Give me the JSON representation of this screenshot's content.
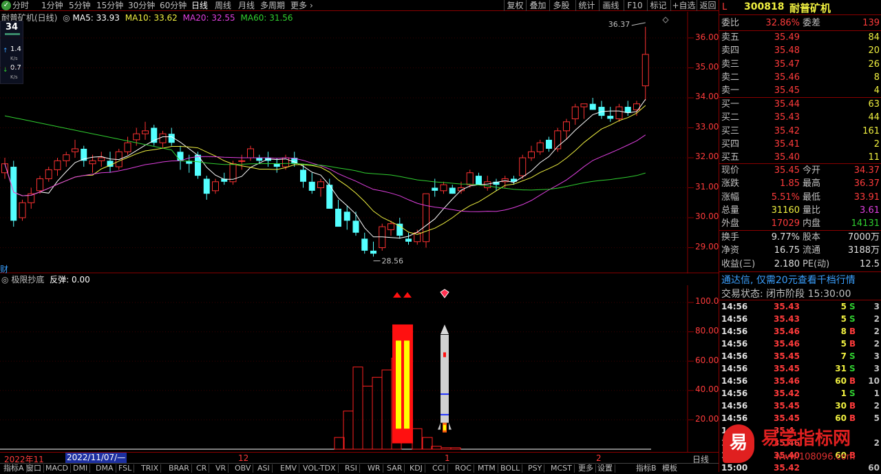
{
  "stock": {
    "code": "300818",
    "name": "耐普矿机",
    "market_flag": "L"
  },
  "periods": [
    "分时",
    "1分钟",
    "5分钟",
    "15分钟",
    "30分钟",
    "60分钟",
    "日线",
    "周线",
    "月线",
    "多周期",
    "更多"
  ],
  "active_period": "日线",
  "toolbar": [
    "复权",
    "叠加",
    "多股",
    "统计",
    "画线",
    "F10",
    "标记",
    "+自选",
    "返回"
  ],
  "chart_title": "耐普矿机(日线)",
  "ma": {
    "ma5": "MA5: 33.93",
    "ma10": "MA10: 33.62",
    "ma20": "MA20: 32.55",
    "ma60": "MA60: 31.56"
  },
  "ma_colors": {
    "ma5": "#ffffff",
    "ma10": "#f0f040",
    "ma20": "#e040e0",
    "ma60": "#30d030"
  },
  "side_info": {
    "count": "34",
    "up_val": "1.4",
    "up_unit": "K/s",
    "down_val": "0.7",
    "down_unit": "K/s"
  },
  "price_axis": [
    "36.00",
    "35.00",
    "34.00",
    "33.00",
    "32.00",
    "31.00",
    "30.00",
    "29.00"
  ],
  "annotations": {
    "high": "36.37",
    "low": "28.56"
  },
  "cai_label": "财",
  "indicator": {
    "name": "极限抄底",
    "value_label": "反弹: 0.00"
  },
  "indicator_axis": [
    "100.0",
    "80.00",
    "60.00",
    "40.00",
    "20.00"
  ],
  "date_axis": {
    "start": "2022年11",
    "cursor": "2022/11/07/—",
    "m12": "12",
    "m1": "1",
    "m2": "2",
    "period": "日线"
  },
  "quote": {
    "weibi": {
      "label": "委比",
      "value": "32.86%",
      "label2": "委差",
      "value2": "139"
    },
    "sell": [
      {
        "label": "卖五",
        "price": "35.49",
        "vol": "84"
      },
      {
        "label": "卖四",
        "price": "35.48",
        "vol": "20"
      },
      {
        "label": "卖三",
        "price": "35.47",
        "vol": "26"
      },
      {
        "label": "卖二",
        "price": "35.46",
        "vol": "8"
      },
      {
        "label": "卖一",
        "price": "35.45",
        "vol": "4"
      }
    ],
    "buy": [
      {
        "label": "买一",
        "price": "35.44",
        "vol": "63"
      },
      {
        "label": "买二",
        "price": "35.43",
        "vol": "44"
      },
      {
        "label": "买三",
        "price": "35.42",
        "vol": "161"
      },
      {
        "label": "买四",
        "price": "35.41",
        "vol": "2"
      },
      {
        "label": "买五",
        "price": "35.40",
        "vol": "11"
      }
    ],
    "stats": [
      {
        "l1": "现价",
        "v1": "35.45",
        "l2": "今开",
        "v2": "34.37"
      },
      {
        "l1": "涨跌",
        "v1": "1.85",
        "l2": "最高",
        "v2": "36.37"
      },
      {
        "l1": "涨幅",
        "v1": "5.51%",
        "l2": "最低",
        "v2": "33.91"
      },
      {
        "l1": "总量",
        "v1": "31160",
        "l2": "量比",
        "v2": "3.61"
      },
      {
        "l1": "外盘",
        "v1": "17029",
        "l2": "内盘",
        "v2": "14131"
      }
    ],
    "stats2": [
      {
        "l1": "换手",
        "v1": "9.77%",
        "l2": "股本",
        "v2": "7000万"
      },
      {
        "l1": "净资",
        "v1": "16.75",
        "l2": "流通",
        "v2": "3188万"
      },
      {
        "l1": "收益(三)",
        "v1": "2.180",
        "l2": "PE(动)",
        "v2": "12.5"
      }
    ],
    "promo": "通达信, 仅需20元查看千档行情",
    "status": "交易状态: 闭市阶段 15:30:00"
  },
  "trades": [
    {
      "time": "14:56",
      "price": "35.43",
      "vol": "5",
      "bs": "S",
      "n": "3"
    },
    {
      "time": "14:56",
      "price": "35.43",
      "vol": "5",
      "bs": "S",
      "n": "2"
    },
    {
      "time": "14:56",
      "price": "35.46",
      "vol": "8",
      "bs": "B",
      "n": "2"
    },
    {
      "time": "14:56",
      "price": "35.46",
      "vol": "5",
      "bs": "B",
      "n": "2"
    },
    {
      "time": "14:56",
      "price": "35.45",
      "vol": "7",
      "bs": "S",
      "n": "3"
    },
    {
      "time": "14:56",
      "price": "35.45",
      "vol": "31",
      "bs": "S",
      "n": "3"
    },
    {
      "time": "14:56",
      "price": "35.46",
      "vol": "60",
      "bs": "B",
      "n": "10"
    },
    {
      "time": "14:56",
      "price": "35.42",
      "vol": "1",
      "bs": "S",
      "n": "1"
    },
    {
      "time": "14:56",
      "price": "35.45",
      "vol": "30",
      "bs": "B",
      "n": "2"
    },
    {
      "time": "14:56",
      "price": "35.45",
      "vol": "60",
      "bs": "B",
      "n": "5"
    },
    {
      "time": "14:56",
      "price": "35.4",
      "vol": "",
      "bs": "",
      "n": ""
    },
    {
      "time": "14:56",
      "price": "35.46",
      "vol": "",
      "bs": "",
      "n": "2"
    },
    {
      "time": "14:56",
      "price": "35.40",
      "vol": "60",
      "bs": "B",
      "n": ""
    },
    {
      "time": "15:00",
      "price": "35.42",
      "vol": "",
      "bs": "",
      "n": "60"
    }
  ],
  "bottom_tabs": [
    "指标A",
    "窗口",
    "MACD",
    "DMI",
    "DMA",
    "FSL",
    "TRIX",
    "BRAR",
    "CR",
    "VR",
    "OBV",
    "ASI",
    "EMV",
    "VOL-TDX",
    "RSI",
    "WR",
    "SAR",
    "KDJ",
    "CCI",
    "ROC",
    "MTM",
    "BOLL",
    "PSY",
    "MCST",
    "更多",
    "设置"
  ],
  "bottom_right": [
    "指标B",
    "模板"
  ],
  "watermark": {
    "brand": "易",
    "text": "易学指标网",
    "url": "www.108096.com"
  },
  "candles_note": "approximate daily OHLC read from chart",
  "chart_data": {
    "type": "candlestick",
    "ohlc": [
      [
        31.5,
        32.0,
        31.3,
        31.8
      ],
      [
        31.7,
        31.9,
        29.7,
        29.9
      ],
      [
        30.0,
        30.6,
        29.9,
        30.5
      ],
      [
        30.5,
        31.0,
        30.3,
        30.8
      ],
      [
        30.9,
        31.4,
        30.8,
        31.3
      ],
      [
        31.3,
        31.7,
        31.2,
        31.6
      ],
      [
        31.6,
        32.0,
        31.4,
        31.9
      ],
      [
        31.9,
        32.2,
        31.7,
        32.1
      ],
      [
        32.2,
        32.6,
        32.0,
        32.3
      ],
      [
        32.3,
        32.4,
        31.7,
        31.9
      ],
      [
        31.8,
        32.1,
        31.5,
        31.9
      ],
      [
        31.9,
        32.2,
        31.7,
        32.0
      ],
      [
        31.9,
        32.2,
        31.5,
        31.7
      ],
      [
        31.7,
        32.3,
        31.6,
        32.2
      ],
      [
        32.2,
        32.7,
        32.1,
        32.5
      ],
      [
        32.6,
        33.0,
        32.4,
        32.8
      ],
      [
        32.8,
        33.2,
        32.6,
        32.9
      ],
      [
        33.0,
        33.1,
        32.4,
        32.5
      ],
      [
        32.5,
        32.9,
        32.3,
        32.8
      ],
      [
        32.8,
        33.0,
        32.4,
        32.5
      ],
      [
        32.2,
        32.4,
        31.6,
        31.9
      ],
      [
        31.9,
        32.1,
        31.5,
        31.8
      ],
      [
        32.1,
        32.2,
        31.3,
        31.4
      ],
      [
        31.3,
        31.4,
        30.6,
        30.8
      ],
      [
        30.9,
        31.3,
        30.8,
        31.2
      ],
      [
        31.3,
        31.5,
        31.1,
        31.2
      ],
      [
        31.2,
        31.9,
        31.1,
        31.8
      ],
      [
        31.9,
        32.1,
        31.6,
        31.9
      ],
      [
        32.0,
        32.4,
        31.9,
        32.3
      ],
      [
        32.0,
        32.1,
        31.8,
        31.9
      ],
      [
        32.0,
        32.2,
        31.7,
        31.9
      ],
      [
        31.8,
        32.0,
        31.5,
        31.7
      ],
      [
        31.7,
        32.1,
        31.6,
        32.0
      ],
      [
        32.0,
        32.2,
        31.7,
        31.8
      ],
      [
        31.6,
        31.8,
        31.0,
        31.2
      ],
      [
        31.2,
        31.5,
        30.8,
        30.9
      ],
      [
        31.0,
        31.3,
        30.7,
        31.2
      ],
      [
        31.1,
        31.3,
        30.3,
        30.3
      ],
      [
        30.3,
        30.6,
        29.7,
        29.7
      ],
      [
        30.2,
        30.4,
        29.6,
        29.9
      ],
      [
        29.9,
        30.2,
        29.4,
        29.5
      ],
      [
        29.3,
        29.5,
        28.8,
        28.9
      ],
      [
        28.9,
        29.2,
        28.7,
        28.8
      ],
      [
        29.0,
        29.8,
        28.9,
        29.7
      ],
      [
        29.6,
        29.9,
        29.4,
        29.8
      ],
      [
        29.8,
        30.0,
        29.3,
        29.4
      ],
      [
        29.3,
        29.5,
        29.1,
        29.2
      ],
      [
        29.2,
        29.6,
        29.1,
        29.5
      ],
      [
        29.2,
        30.8,
        29.0,
        30.8
      ],
      [
        31.0,
        31.3,
        30.7,
        30.9
      ],
      [
        30.9,
        31.2,
        30.8,
        31.1
      ],
      [
        31.0,
        31.1,
        30.8,
        30.8
      ],
      [
        30.9,
        31.2,
        30.8,
        31.0
      ],
      [
        31.1,
        31.6,
        31.0,
        31.5
      ],
      [
        31.4,
        31.5,
        31.1,
        31.1
      ],
      [
        31.0,
        31.4,
        30.9,
        31.2
      ],
      [
        31.2,
        31.3,
        30.9,
        31.1
      ],
      [
        31.2,
        31.4,
        31.0,
        31.3
      ],
      [
        31.3,
        31.4,
        31.1,
        31.2
      ],
      [
        31.4,
        32.1,
        31.3,
        32.0
      ],
      [
        32.0,
        32.4,
        31.9,
        32.2
      ],
      [
        32.2,
        32.6,
        32.1,
        32.5
      ],
      [
        32.6,
        32.7,
        32.2,
        32.3
      ],
      [
        32.3,
        33.0,
        32.2,
        32.9
      ],
      [
        32.9,
        33.3,
        32.6,
        33.2
      ],
      [
        33.3,
        33.8,
        33.1,
        33.7
      ],
      [
        33.7,
        33.8,
        33.3,
        33.8
      ],
      [
        33.8,
        34.0,
        33.6,
        33.6
      ],
      [
        33.7,
        33.9,
        33.3,
        33.4
      ],
      [
        33.4,
        33.7,
        33.2,
        33.3
      ],
      [
        33.3,
        33.8,
        33.2,
        33.7
      ],
      [
        33.7,
        33.9,
        33.4,
        33.5
      ],
      [
        33.6,
        33.9,
        33.4,
        33.8
      ],
      [
        34.4,
        36.37,
        33.91,
        35.45
      ]
    ],
    "indicator_bars": "approximate"
  }
}
